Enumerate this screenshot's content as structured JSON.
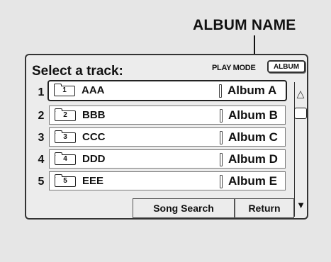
{
  "callout": {
    "label": "ALBUM NAME"
  },
  "header": {
    "title": "Select a track:",
    "play_mode_label": "PLAY MODE",
    "album_button_label": "ALBUM"
  },
  "tracks": [
    {
      "num": "1",
      "folder": "1",
      "name": "AAA",
      "album": "Album A",
      "selected": true
    },
    {
      "num": "2",
      "folder": "2",
      "name": "BBB",
      "album": "Album B",
      "selected": false
    },
    {
      "num": "3",
      "folder": "3",
      "name": "CCC",
      "album": "Album C",
      "selected": false
    },
    {
      "num": "4",
      "folder": "4",
      "name": "DDD",
      "album": "Album D",
      "selected": false
    },
    {
      "num": "5",
      "folder": "5",
      "name": "EEE",
      "album": "Album E",
      "selected": false
    }
  ],
  "scroll": {
    "up_glyph": "△",
    "down_glyph": "▼"
  },
  "footer": {
    "song_search_label": "Song Search",
    "return_label": "Return"
  },
  "icons": {
    "folder": "folder-icon",
    "scroll_up": "triangle-up-icon",
    "scroll_down": "triangle-down-icon",
    "callout_arrow": "arrow-down-icon"
  }
}
